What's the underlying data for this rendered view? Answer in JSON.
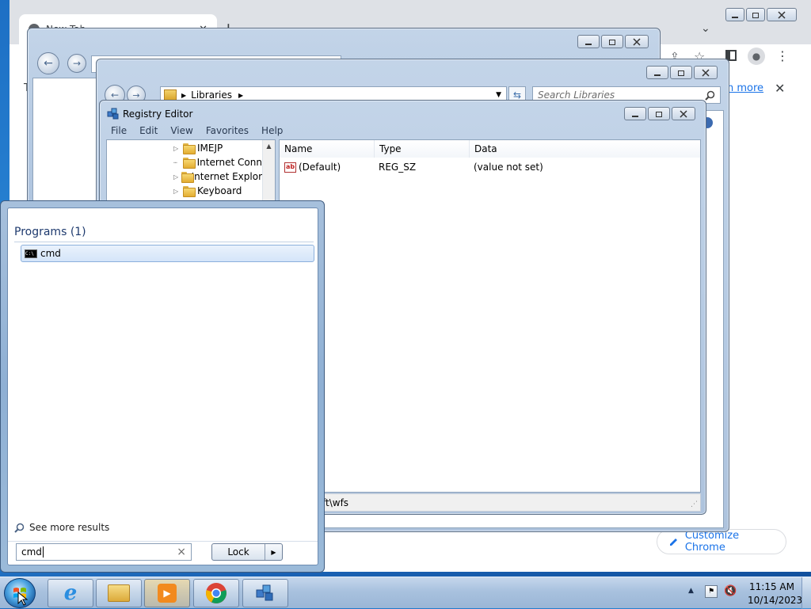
{
  "chrome": {
    "tab_title": "New Tab",
    "new_tab_symbol": "+",
    "body_left_letter": "T",
    "learn_more": "n more",
    "customize_label": "Customize Chrome"
  },
  "explorer_back": {
    "title": ""
  },
  "explorer_front": {
    "address": "Libraries",
    "search_placeholder": "Search Libraries"
  },
  "regedit": {
    "title": "Registry Editor",
    "menu": [
      "File",
      "Edit",
      "View",
      "Favorites",
      "Help"
    ],
    "tree": [
      "IMEJP",
      "Internet Conn",
      "Internet Explor",
      "Keyboard"
    ],
    "columns": [
      "Name",
      "Type",
      "Data"
    ],
    "rows": [
      {
        "name": "(Default)",
        "type": "REG_SZ",
        "data": "(value not set)"
      }
    ],
    "status_path": "ft\\wfs"
  },
  "startmenu": {
    "programs_header": "Programs (1)",
    "result_label": "cmd",
    "see_more": "See more results",
    "search_value": "cmd",
    "clear_symbol": "×",
    "lock_label": "Lock"
  },
  "taskbar": {
    "time": "11:15 AM",
    "date": "10/14/2023",
    "apps": [
      "start",
      "internet-explorer",
      "windows-explorer",
      "media-player",
      "chrome",
      "registry-editor"
    ]
  },
  "colors": {
    "desktop": "#1d6fc4",
    "chrome_accent": "#1a73e8",
    "selection": "#dbe8f8"
  }
}
